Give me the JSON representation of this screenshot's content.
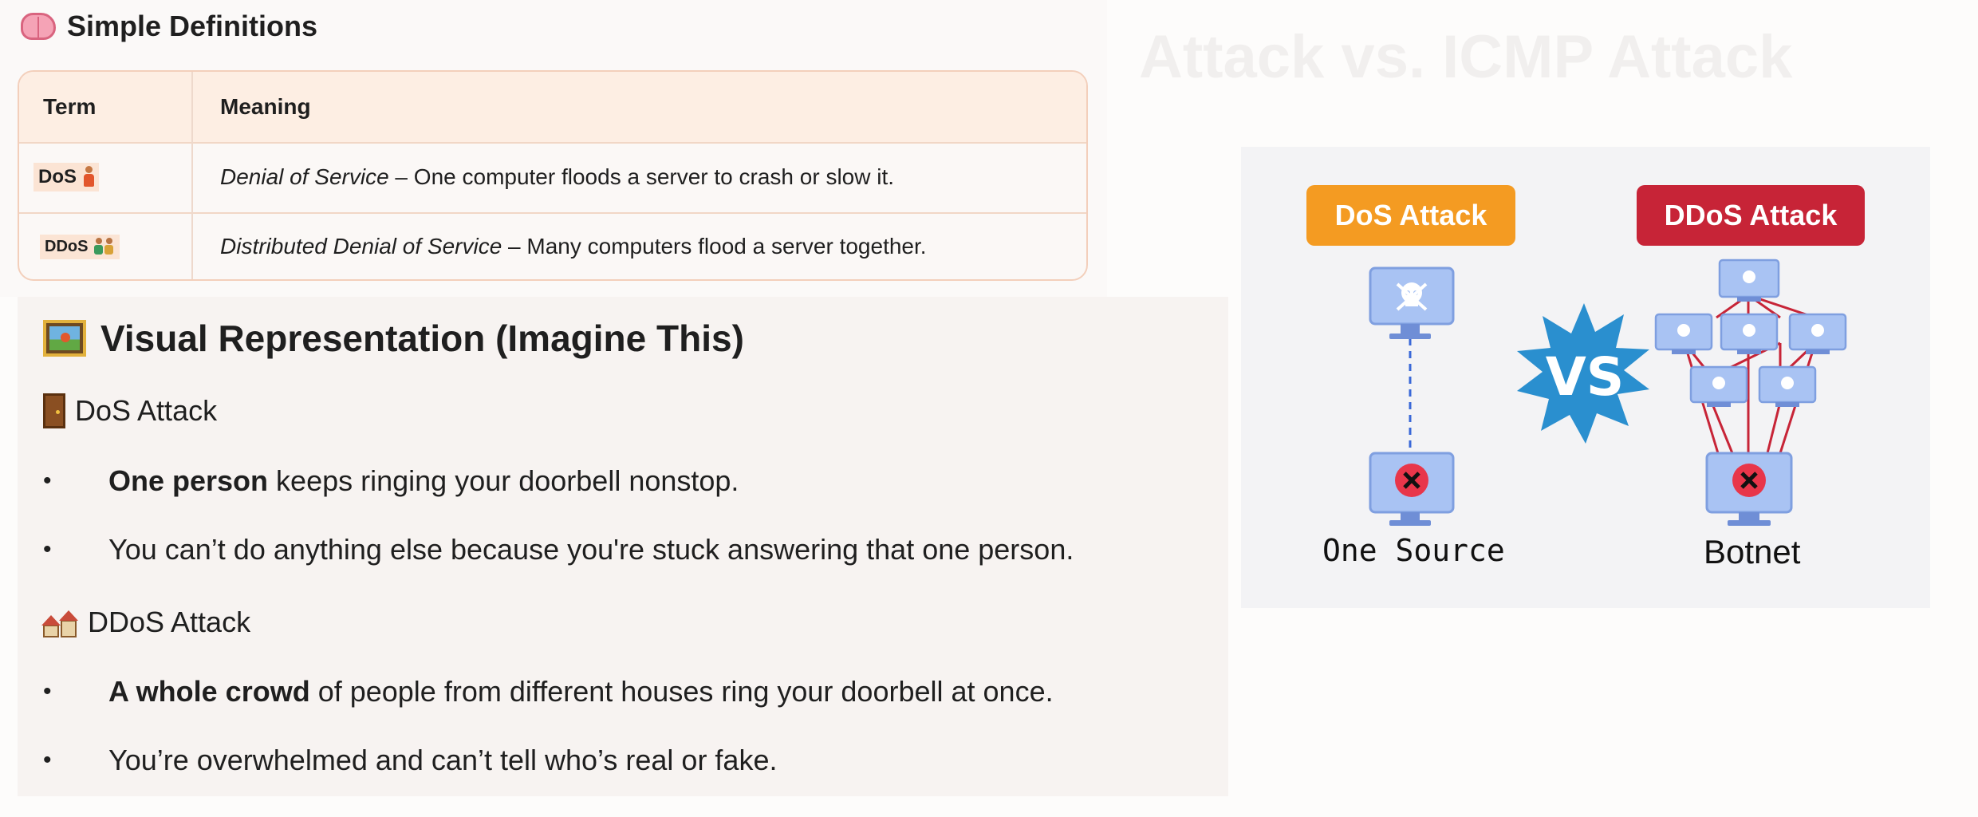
{
  "definitions": {
    "heading": "Simple Definitions",
    "heading_icon": "brain-icon",
    "columns": [
      "Term",
      "Meaning"
    ],
    "rows": [
      {
        "term": "DoS",
        "term_icon": "person-icon",
        "meaning_italic": "Denial of Service",
        "meaning_rest": " – One computer floods a server to crash or slow it."
      },
      {
        "term": "DDoS",
        "term_icon": "people-icon",
        "meaning_italic": "Distributed Denial of Service",
        "meaning_rest": " – Many computers flood a server together."
      }
    ]
  },
  "visual": {
    "heading": "Visual Representation (Imagine This)",
    "heading_icon": "framed-picture-icon",
    "dos": {
      "label": "DoS Attack",
      "icon": "door-icon",
      "bullets": [
        {
          "bold": "One person",
          "text": " keeps ringing your doorbell nonstop."
        },
        {
          "bold": "",
          "text": "You can’t do anything else because you're stuck answering that one person."
        }
      ]
    },
    "ddos": {
      "label": "DDoS Attack",
      "icon": "houses-icon",
      "bullets": [
        {
          "bold": "A whole crowd",
          "text": " of people from different houses ring your doorbell at once."
        },
        {
          "bold": "",
          "text": "You’re overwhelmed and can’t tell who’s real or fake."
        }
      ]
    },
    "bullet_char": "•"
  },
  "diagram": {
    "faded_title": "Attack vs. ICMP Attack",
    "left_label": "DoS Attack",
    "right_label": "DDoS Attack",
    "vs": "VS",
    "left_caption": "One Source",
    "right_caption": "Botnet",
    "colors": {
      "dos": "#f49b22",
      "ddos": "#c72437",
      "vs": "#2a8fcf",
      "monitor": "#a9c3f3",
      "x_mark": "#e8364a"
    }
  }
}
